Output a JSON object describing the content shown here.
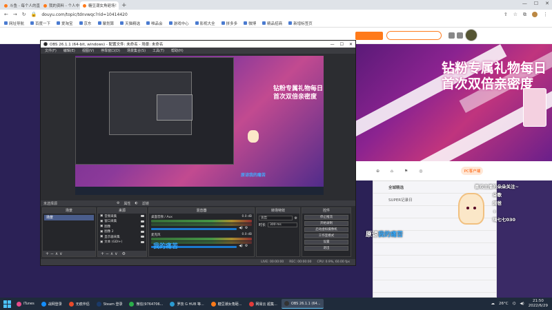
{
  "browser": {
    "tabs": [
      {
        "label": "斗鱼 - 每个人的直播平台",
        "active": false
      },
      {
        "label": "我的资料 - 个人中心 - 斗鱼",
        "active": false
      },
      {
        "label": "糖豆潮女角砸场！参与活动领到",
        "active": true
      }
    ],
    "new_tab": "+",
    "window_controls": {
      "min": "—",
      "max": "☐",
      "close": "✕"
    },
    "url": "douyu.com/topic/tdnvwqc?rid=10414420",
    "bookmarks": [
      "网址导航",
      "百度一下",
      "爱淘宝",
      "京东",
      "聚划算",
      "天猫精选",
      "唯品会",
      "游戏中心",
      "影视大全",
      "拼多多",
      "微博",
      "精品招商",
      "新增标签页"
    ]
  },
  "page": {
    "promo_text": "钻粉专属礼物每日\n首次双倍亲密度",
    "below_items": [
      "",
      "",
      "",
      ""
    ],
    "pc_button": "PC客户端",
    "follow_lines": [
      "喜欢主播的朵朵关注~",
      "朵歌",
      "阔爸",
      "+",
      "嗨七七030"
    ],
    "chat_title": "全城精选",
    "chat_rows": [
      "SUPER记录日",
      "",
      "",
      "",
      "",
      "",
      ""
    ],
    "yuanliang": "原谅",
    "yuanliang_hl": "我的痛苦"
  },
  "obs": {
    "title": "OBS 26.1.1 (64-bit, windows) - 配置文件: 未命名 - 场景: 未命名",
    "menu": [
      "文件(F)",
      "编辑(E)",
      "视图(V)",
      "停靠窗口(D)",
      "场景集合(S)",
      "工具(T)",
      "帮助(H)"
    ],
    "preview_promo": "钻粉专属礼物每日\n首次双倍亲密度",
    "preview_caption": "原谅我的痛苦",
    "source_bar": [
      "未选择源",
      "属性",
      "滤镜"
    ],
    "docks": {
      "scenes": "场景",
      "sources": "来源",
      "mixer": "混音器",
      "transitions": "转场特效",
      "controls": "控件"
    },
    "scene_items": [
      "场景"
    ],
    "source_items": [
      "音频采集",
      "窗口采集",
      "图像",
      "图像 2",
      "显示器采集",
      "文本 (GDI+)"
    ],
    "mixer_tracks": [
      {
        "name": "桌面音频 / Aux",
        "level": "0.0 dB"
      },
      {
        "name": "麦克风",
        "level": "0.0 dB"
      }
    ],
    "mixer_caption": "我的痛苦",
    "transition": {
      "type": "淡出",
      "duration_label": "时长",
      "duration": "300 ms"
    },
    "controls": [
      "停止推流",
      "开始录制",
      "启动虚拟摄像机",
      "工作室模式",
      "设置",
      "退出"
    ],
    "status": [
      "LIVE: 00:00:00",
      "REC: 00:00:00",
      "CPU: 0.9%, 60.00 fps"
    ],
    "foot_symbols": "+  −  ∧  ∨"
  },
  "taskbar": {
    "items": [
      {
        "label": "iTunes",
        "color": "#e84a8a",
        "active": false
      },
      {
        "label": "战网登录",
        "color": "#148eff",
        "active": false
      },
      {
        "label": "无痕伴侣",
        "color": "#e84a2a",
        "active": false
      },
      {
        "label": "Steam 登录",
        "color": "#1a3a6a",
        "active": false
      },
      {
        "label": "微信(9764706...",
        "color": "#2aae4a",
        "active": false
      },
      {
        "label": "罗技 G HUB 等...",
        "color": "#2a9ad0",
        "active": false
      },
      {
        "label": "糖豆潮女角砸...",
        "color": "#ff7a1a",
        "active": false
      },
      {
        "label": "网易云 超集...",
        "color": "#e23a3a",
        "active": false
      },
      {
        "label": "OBS 26.1.1 (64...",
        "color": "#333333",
        "active": true
      }
    ],
    "weather": "26°C",
    "time": "21:50",
    "date": "2022/6/29"
  }
}
